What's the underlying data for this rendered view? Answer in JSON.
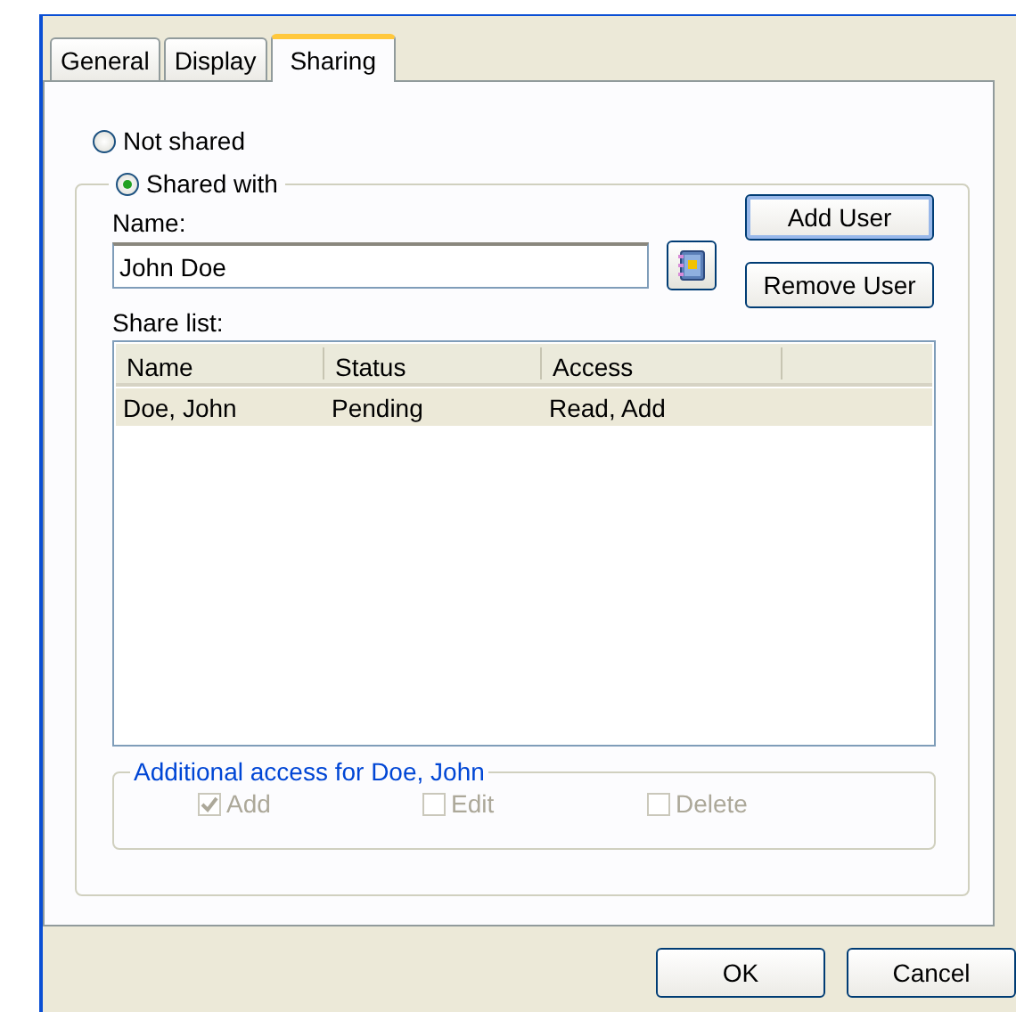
{
  "tabs": [
    {
      "label": "General",
      "selected": false
    },
    {
      "label": "Display",
      "selected": false
    },
    {
      "label": "Sharing",
      "selected": true
    }
  ],
  "sharing_options": [
    {
      "label": "Not shared",
      "selected": false
    },
    {
      "label": "Shared with",
      "selected": true
    }
  ],
  "name_label": "Name:",
  "name_field": {
    "value": "John Doe"
  },
  "user_buttons": [
    {
      "label": "Add User",
      "default": true
    },
    {
      "label": "Remove User",
      "default": false
    }
  ],
  "share_list_label": "Share list:",
  "share_list": {
    "columns": [
      "Name",
      "Status",
      "Access"
    ],
    "rows": [
      {
        "cells": [
          "Doe, John",
          "Pending",
          "Read, Add"
        ],
        "selected": true
      }
    ]
  },
  "additional_access": {
    "title": "Additional access for Doe, John",
    "options": [
      {
        "label": "Add",
        "checked": true,
        "disabled": true
      },
      {
        "label": "Edit",
        "checked": false,
        "disabled": true
      },
      {
        "label": "Delete",
        "checked": false,
        "disabled": true
      }
    ]
  },
  "dialog_buttons": [
    {
      "label": "OK"
    },
    {
      "label": "Cancel"
    }
  ]
}
